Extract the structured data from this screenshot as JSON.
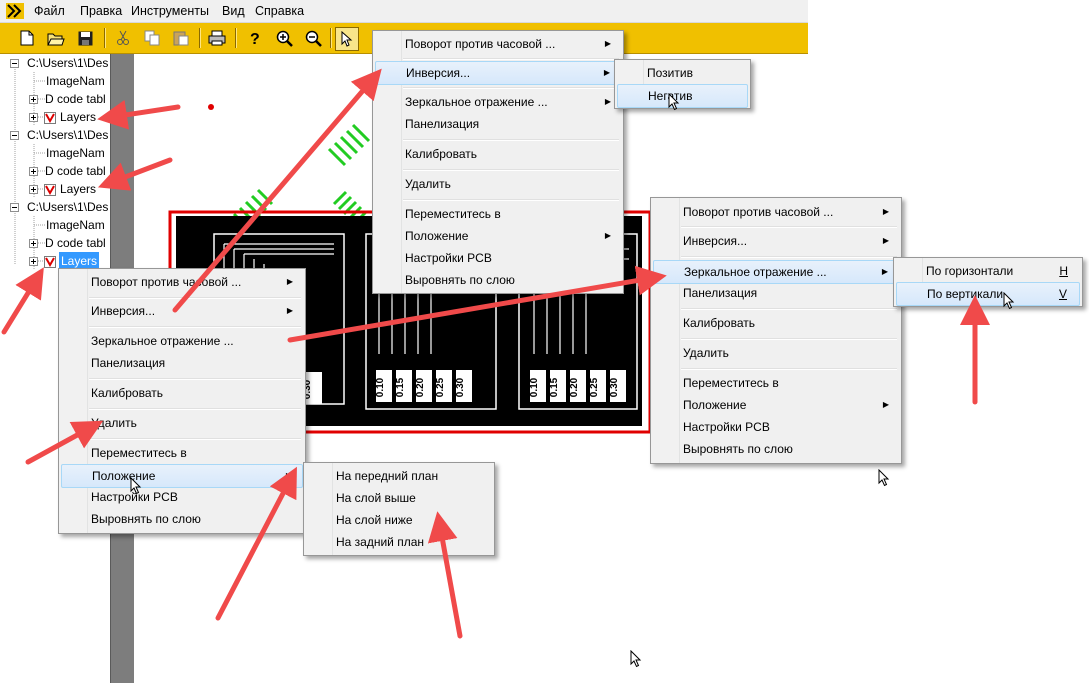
{
  "menubar": {
    "items": [
      "Файл",
      "Правка",
      "Инструменты",
      "Вид",
      "Справка"
    ]
  },
  "tree": {
    "root_label": "C:\\Users\\1\\Des",
    "image_label": "ImageNam",
    "dcode_label": "D code tabl",
    "layers_label": "Layers"
  },
  "menu_main": {
    "rotate": "Поворот против часовой ...",
    "invert": "Инверсия...",
    "mirror": "Зеркальное отражение ...",
    "panel": "Панелизация",
    "calibrate": "Калибровать",
    "delete": "Удалить",
    "move_to": "Переместитесь в",
    "position": "Положение",
    "pcb_settings": "Настройки PCB",
    "align": "Выровнять по слою"
  },
  "submenu_invert": {
    "positive": "Позитив",
    "negative": "Негатив"
  },
  "submenu_mirror": {
    "horizontal": "По горизонтали",
    "horizontal_key": "H",
    "vertical": "По вертикали",
    "vertical_key": "V"
  },
  "submenu_position": {
    "front": "На передний план",
    "up": "На слой выше",
    "down": "На слой ниже",
    "back": "На задний план"
  },
  "pcb": {
    "labels": [
      "0.10",
      "0.15",
      "0.20",
      "0.25",
      "0.30"
    ]
  },
  "colors": {
    "toolbar": "#f0c000",
    "arrow": "#f04a4a",
    "selection": "#3399ff",
    "pcb_green": "#22cc22"
  }
}
